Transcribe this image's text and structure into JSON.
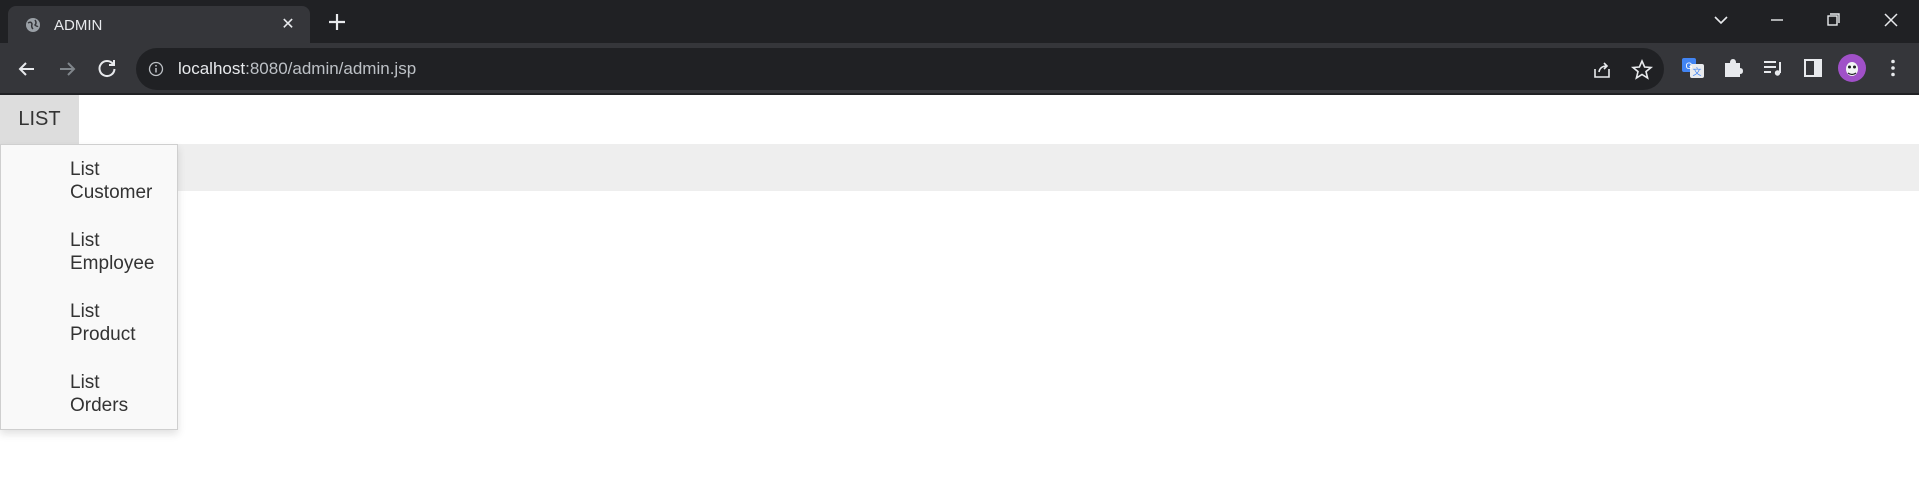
{
  "browser": {
    "tab_title": "ADMIN",
    "url_host": "localhost",
    "url_rest": ":8080/admin/admin.jsp"
  },
  "icons": {
    "tab": "globe-icon",
    "close": "close-icon",
    "new_tab": "plus-icon",
    "back": "back-arrow-icon",
    "forward": "forward-arrow-icon",
    "reload": "reload-icon",
    "info": "info-icon",
    "share": "share-icon",
    "bookmark": "star-icon",
    "translate": "translate-icon",
    "extensions": "puzzle-icon",
    "media": "media-queue-icon",
    "side_panel": "side-panel-icon",
    "profile": "profile-avatar-icon",
    "menu": "kebab-menu-icon"
  },
  "nav": {
    "list_label": "LIST",
    "dropdown": [
      {
        "line1": "List",
        "line2": "Customer"
      },
      {
        "line1": "List",
        "line2": "Employee"
      },
      {
        "line1": "List",
        "line2": "Product"
      },
      {
        "line1": "List",
        "line2": "Orders"
      }
    ]
  },
  "colors": {
    "titlebar": "#202124",
    "toolbar": "#35363a",
    "nav_button_bg": "#dddddd",
    "subbar_bg": "#eeeeee",
    "dropdown_bg": "#f9f9f9",
    "text": "#333333"
  }
}
